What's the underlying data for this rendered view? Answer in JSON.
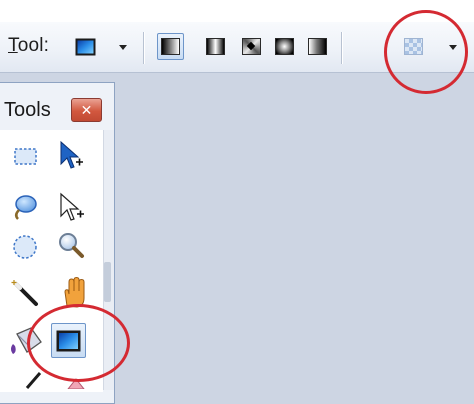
{
  "toolbar": {
    "tool_label_underlined": "T",
    "tool_label_rest": "ool:",
    "current_tool_icon": "gradient-tool-icon",
    "gradient_types": [
      {
        "icon": "linear-gradient-icon",
        "selected": true
      },
      {
        "icon": "linear-reflected-gradient-icon",
        "selected": false
      },
      {
        "icon": "diamond-gradient-icon",
        "selected": false
      },
      {
        "icon": "radial-gradient-icon",
        "selected": false
      },
      {
        "icon": "conical-gradient-icon",
        "selected": false
      }
    ],
    "color_mode_icon": "transparency-mode-icon"
  },
  "tools_panel": {
    "title": "Tools",
    "close_icon": "close-icon",
    "close_glyph": "✕",
    "tools": [
      "rectangle-select-icon",
      "move-selection-icon",
      "lasso-select-icon",
      "move-selection-outline-icon",
      "ellipse-select-icon",
      "zoom-icon",
      "magic-wand-icon",
      "pan-icon",
      "paint-bucket-icon",
      "gradient-icon"
    ],
    "selected_tool": "gradient-icon"
  },
  "colors": {
    "highlight_circle": "#d42a32",
    "canvas_background": "#cdd5e3",
    "accent_blue": "#2b8ee8"
  }
}
